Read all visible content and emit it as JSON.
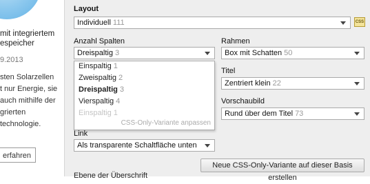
{
  "preview": {
    "title": "mit integriertem\nespeicher",
    "date": "9.2013",
    "body": "sten Solarzellen\nt nur Energie, sie\nauch mithilfe der\ngrierten\ntechnologie.",
    "button": "erfahren"
  },
  "layout": {
    "label": "Layout",
    "value": "Individuell",
    "count": "111",
    "css_badge": "CSS"
  },
  "columns": {
    "label": "Anzahl Spalten",
    "value": "Dreispaltig",
    "count": "3",
    "options": [
      {
        "label": "Einspaltig",
        "count": "1"
      },
      {
        "label": "Zweispaltig",
        "count": "2"
      },
      {
        "label": "Dreispaltig",
        "count": "3"
      },
      {
        "label": "Vierspaltig",
        "count": "4"
      },
      {
        "label": "Einspaltig",
        "count": "1"
      }
    ],
    "css_link": "CSS-Only-Variante anpassen"
  },
  "frame": {
    "label": "Rahmen",
    "value": "Box mit Schatten",
    "count": "50"
  },
  "title": {
    "label": "Titel",
    "value": "Zentriert klein",
    "count": "22"
  },
  "preview_image": {
    "label": "Vorschaubild",
    "value": "Rund über dem Titel",
    "count": "73"
  },
  "link": {
    "label": "Link",
    "value": "Als transparente Schaltfläche unten"
  },
  "create_button": "Neue CSS-Only-Variante auf dieser Basis erstellen",
  "heading_level_label": "Ebene der Überschrift"
}
